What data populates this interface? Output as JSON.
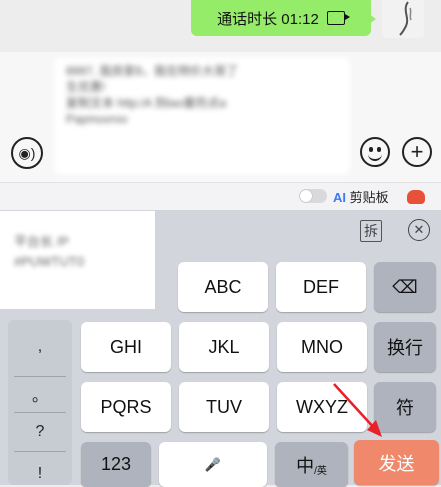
{
  "chat": {
    "bubble_text": "通话时长 01:12",
    "bubble_icon": "video-call-icon"
  },
  "input": {
    "draft_lines": [
      "8997, 我房家8，我在特价大哥了",
      "生优惠!",
      "复制文本 http:/A 到tao重符点a",
      "Papmuvroo"
    ]
  },
  "clipboard": {
    "ai_prefix": "AI",
    "label": "剪贴板"
  },
  "keyboard": {
    "candidate_lines": [
      "平台长 /P",
      "#PUWTUT0"
    ],
    "candidate_icon_glyph": "拆",
    "close_glyph": "✕",
    "side_symbols": [
      ",",
      "。",
      "?",
      "!"
    ],
    "keys": {
      "abc": "ABC",
      "def": "DEF",
      "backspace": "⌫",
      "ghi": "GHI",
      "jkl": "JKL",
      "mno": "MNO",
      "newline": "换行",
      "pqrs": "PQRS",
      "tuv": "TUV",
      "wxyz": "WXYZ",
      "symbols": "符",
      "numbers": "123",
      "space_mic": "🎤",
      "lang_main": "中",
      "lang_sub": "/英",
      "send": "发送"
    }
  },
  "colors": {
    "bubble_green": "#95ec69",
    "send_orange": "#f0896c",
    "arrow_red": "#e8202a"
  }
}
